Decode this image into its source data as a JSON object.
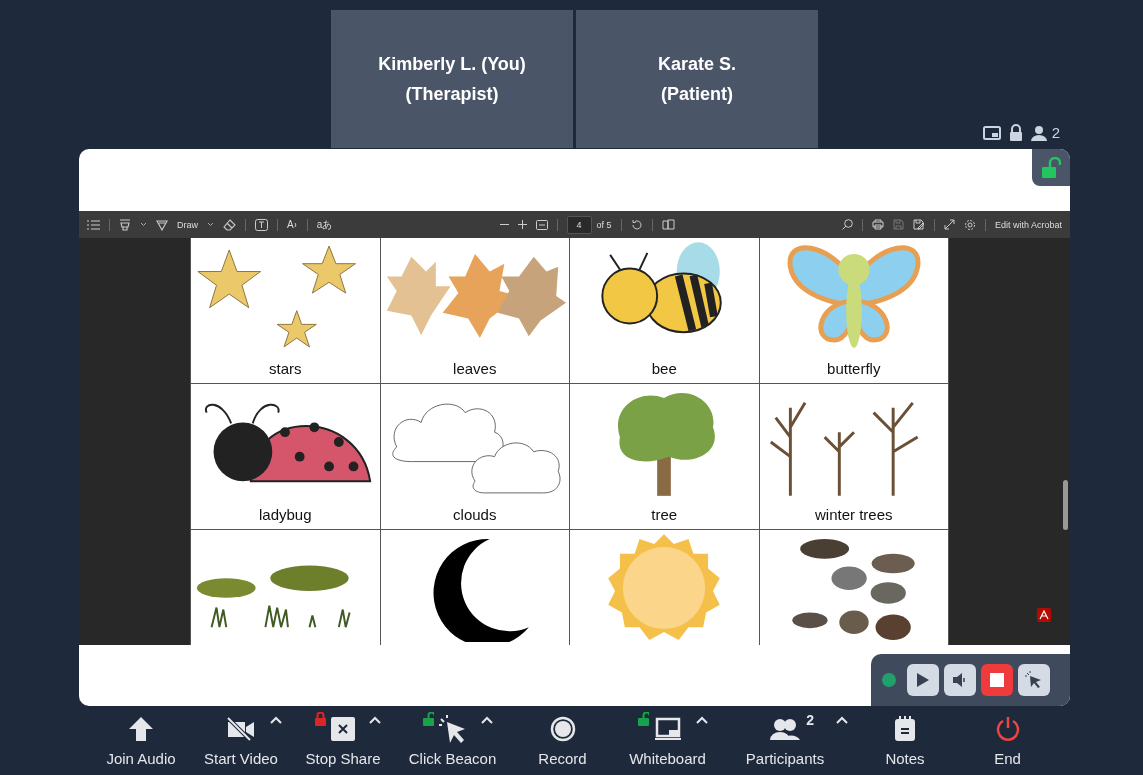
{
  "participants": [
    {
      "name": "Kimberly L. (You)",
      "role": "(Therapist)"
    },
    {
      "name": "Karate S.",
      "role": "(Patient)"
    }
  ],
  "top_bar": {
    "participant_count": "2",
    "share_locked": false
  },
  "pdf_toolbar": {
    "draw_label": "Draw",
    "read_aloud_glyph": "A",
    "translate_glyph": "aあ",
    "page": "4",
    "page_total": "of 5",
    "edit_button": "Edit with Acrobat"
  },
  "pdf_page": {
    "cells": [
      {
        "kind": "stars",
        "label": "stars"
      },
      {
        "kind": "leaves",
        "label": "leaves"
      },
      {
        "kind": "bee",
        "label": "bee"
      },
      {
        "kind": "butterfly",
        "label": "butterfly"
      },
      {
        "kind": "ladybug",
        "label": "ladybug"
      },
      {
        "kind": "clouds",
        "label": "clouds"
      },
      {
        "kind": "tree",
        "label": "tree"
      },
      {
        "kind": "winter_trees",
        "label": "winter trees"
      },
      {
        "kind": "moss"
      },
      {
        "kind": "moon"
      },
      {
        "kind": "sun"
      },
      {
        "kind": "rocks"
      }
    ]
  },
  "recording_controls": {
    "recording": true
  },
  "toolbar": [
    {
      "kind": "audio",
      "label": "Join Audio",
      "caret": false
    },
    {
      "kind": "video",
      "label": "Start Video",
      "caret": true
    },
    {
      "kind": "share",
      "label": "Stop Share",
      "caret": true,
      "locked": true
    },
    {
      "kind": "beacon",
      "label": "Click Beacon",
      "caret": true,
      "locked": false
    },
    {
      "kind": "record",
      "label": "Record",
      "caret": false
    },
    {
      "kind": "whiteboard",
      "label": "Whiteboard",
      "caret": true,
      "locked": false
    },
    {
      "kind": "participants",
      "label": "Participants",
      "caret": true,
      "count": "2"
    },
    {
      "kind": "notes",
      "label": "Notes",
      "caret": false
    },
    {
      "kind": "end",
      "label": "End",
      "caret": false
    }
  ]
}
